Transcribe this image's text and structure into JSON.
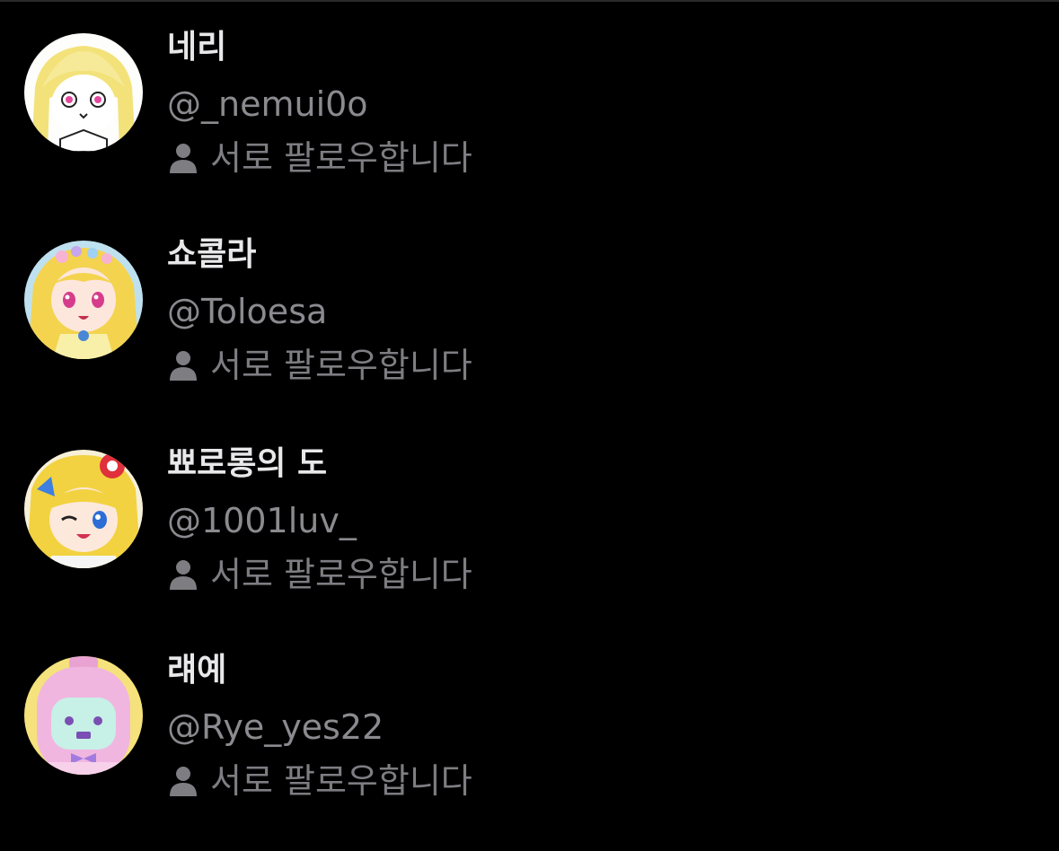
{
  "colors": {
    "background": "#000000",
    "name": "#e8e8ea",
    "secondary": "#8a8a8f"
  },
  "users": [
    {
      "display_name": "네리",
      "handle": "@_nemui0o",
      "follows_label": "서로 팔로우합니다",
      "follows_icon": "person-icon"
    },
    {
      "display_name": "쇼콜라",
      "handle": "@Toloesa",
      "follows_label": "서로 팔로우합니다",
      "follows_icon": "person-icon"
    },
    {
      "display_name": "뾰로롱의 도",
      "handle": "@1001luv_",
      "follows_label": "서로 팔로우합니다",
      "follows_icon": "person-icon"
    },
    {
      "display_name": "럐예",
      "handle": "@Rye_yes22",
      "follows_label": "서로 팔로우합니다",
      "follows_icon": "person-icon"
    }
  ]
}
